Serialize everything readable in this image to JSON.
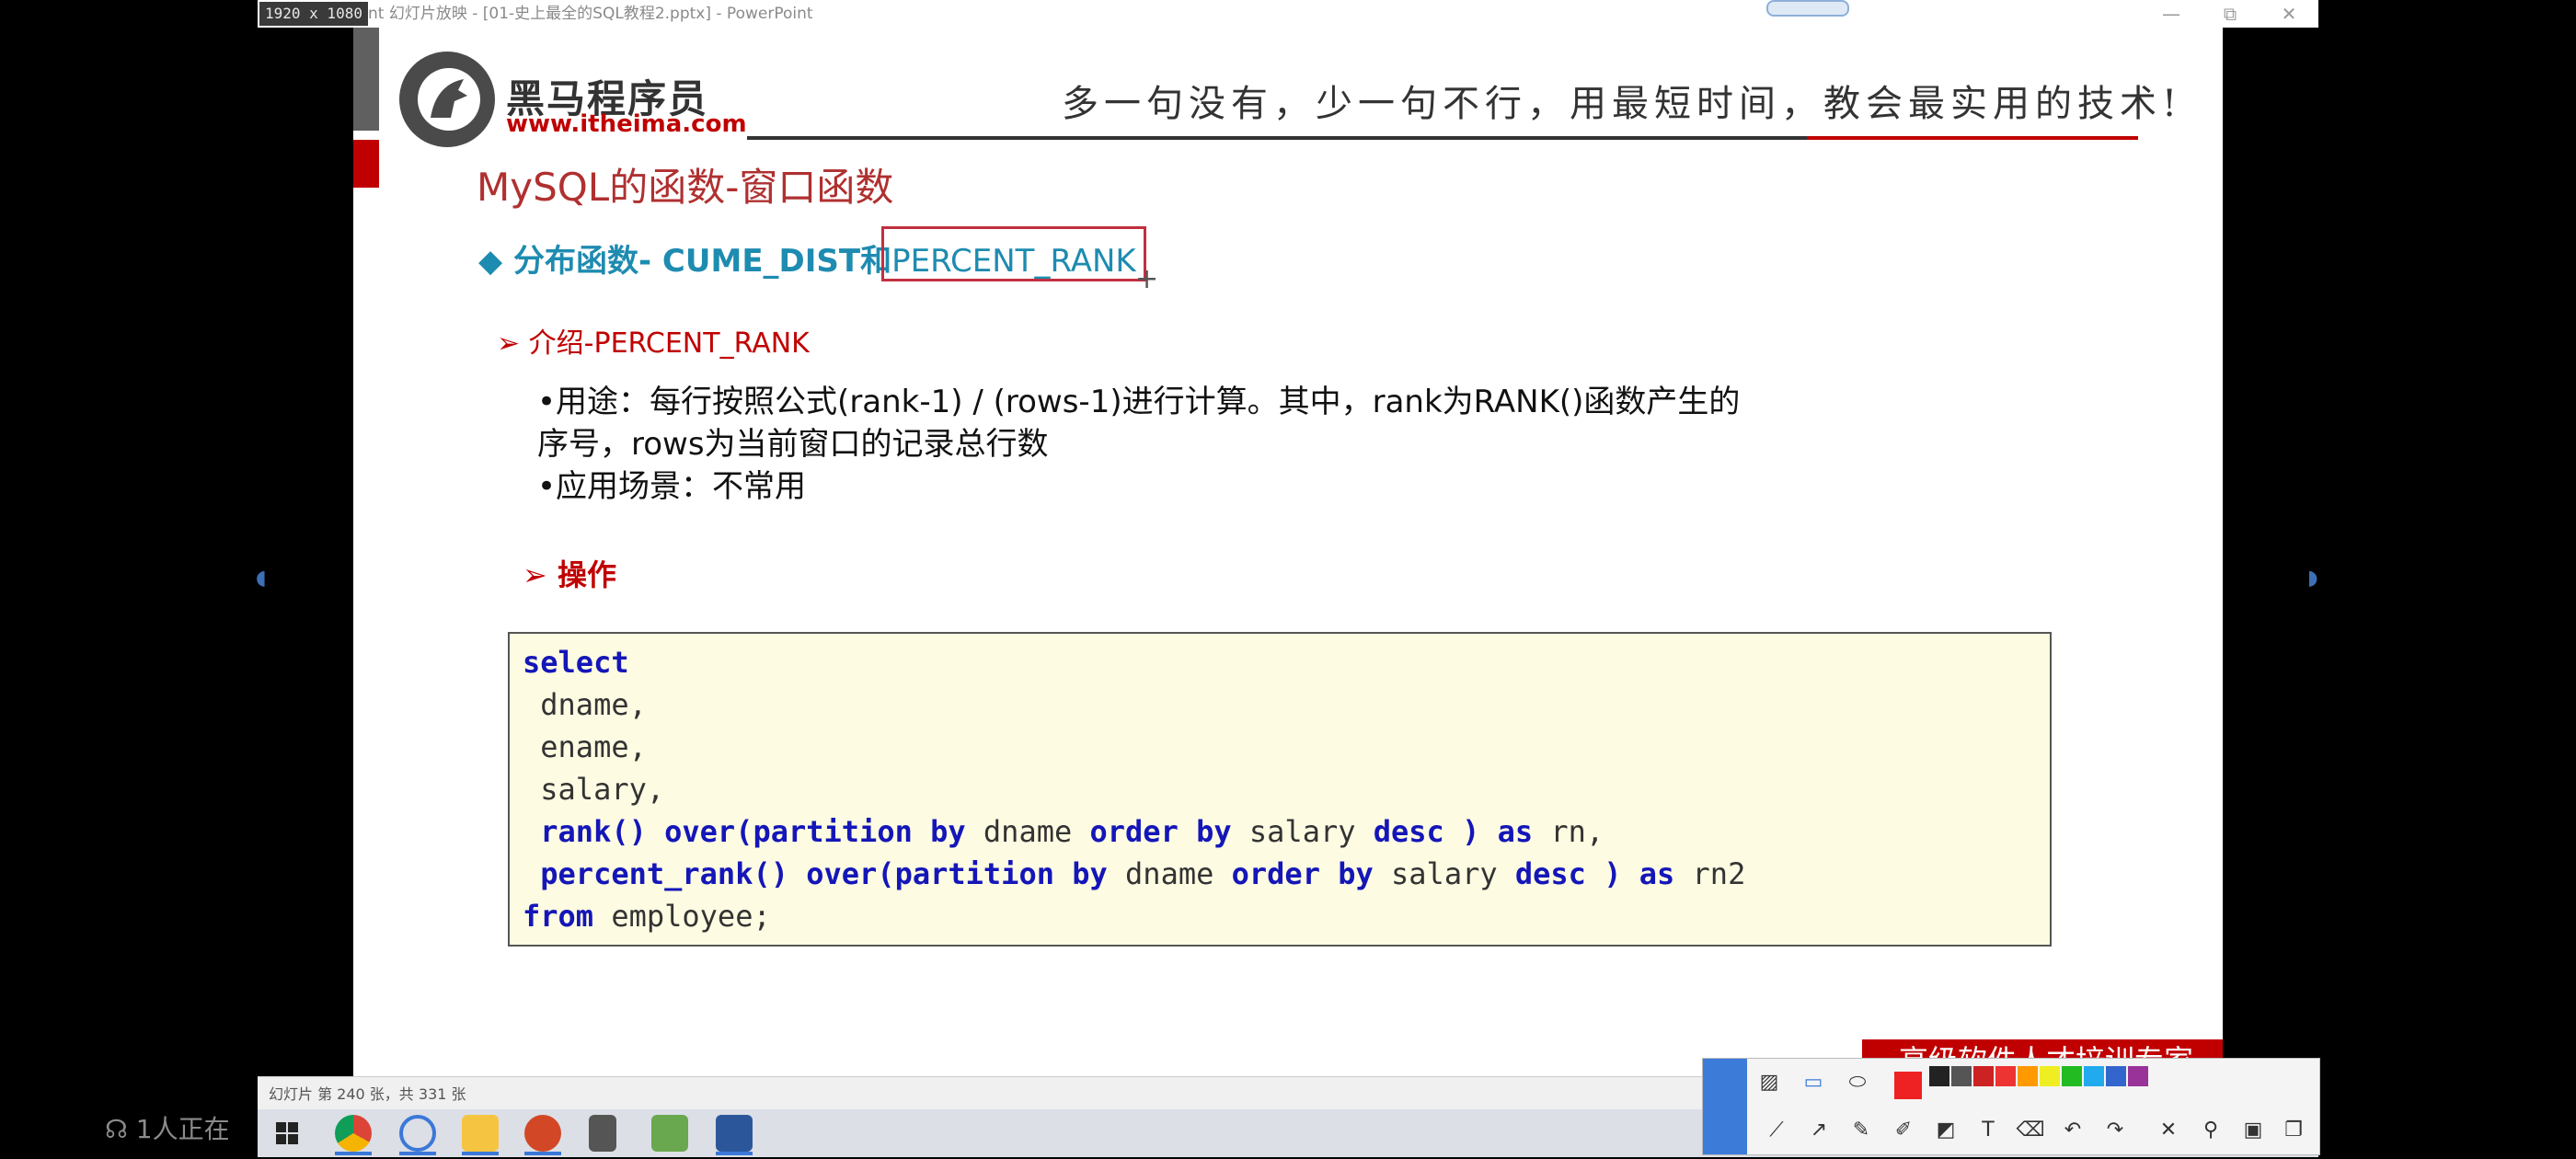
{
  "window": {
    "resolution_badge": "1920 x 1080",
    "title": "nt 幻灯片放映 - [01-史上最全的SQL教程2.pptx] - PowerPoint",
    "minimize": "—",
    "restore": "⧉",
    "close": "✕"
  },
  "slide": {
    "logo_brand": "黑马程序员",
    "logo_url": "www.itheima.com",
    "slogan": "多一句没有，少一句不行，用最短时间，教会最实用的技术!",
    "title": "MySQL的函数-窗口函数",
    "subtitle_prefix": "◆ 分布函数- CUME_DIST和",
    "subtitle_highlight": "PERCENT_RANK",
    "bullet1": "➢  介绍-PERCENT_RANK",
    "body_line1": "•用途：每行按照公式(rank-1) / (rows-1)进行计算。其中，rank为RANK()函数产生的",
    "body_line2": "序号，rows为当前窗口的记录总行数",
    "body_line3": "•应用场景：不常用",
    "bullet2": "➢  操作",
    "code": {
      "l1_kw": "select",
      "l2": " dname,",
      "l3": " ename,",
      "l4": " salary,",
      "l5_kw1": " rank() over(partition by",
      "l5_t1": " dname ",
      "l5_kw2": "order by",
      "l5_t2": " salary ",
      "l5_kw3": "desc ) as",
      "l5_t3": " rn,",
      "l6_kw1": " percent_rank() over(partition by",
      "l6_t1": " dname ",
      "l6_kw2": "order by",
      "l6_t2": " salary ",
      "l6_kw3": "desc ) as",
      "l6_t3": " rn2",
      "l7_kw": "from",
      "l7_t": " employee;"
    },
    "footer": "高级软件人才培训专家"
  },
  "status_bar": {
    "slide_info": "幻灯片 第 240 张，共 331 张"
  },
  "overlay": {
    "viewers": "1人正在"
  },
  "colors": {
    "accent_red": "#c00000",
    "keyword_blue": "#1416b8",
    "subtitle_blue": "#1e8bb0",
    "code_bg": "#fdfbe2"
  },
  "icons": [
    "windows-start-icon",
    "chrome-icon",
    "browser-icon",
    "file-explorer-icon",
    "powerpoint-icon",
    "calculator-icon",
    "image-editor-icon",
    "word-icon"
  ]
}
